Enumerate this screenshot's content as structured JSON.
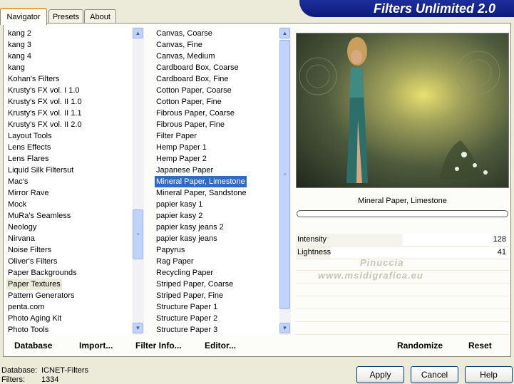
{
  "title": "Filters Unlimited 2.0",
  "tabs": [
    "Navigator",
    "Presets",
    "About"
  ],
  "categories": {
    "items": [
      "kang 2",
      "kang 3",
      "kang 4",
      "kang",
      "Kohan's Filters",
      "Krusty's FX vol. I 1.0",
      "Krusty's FX vol. II 1.0",
      "Krusty's FX vol. II 1.1",
      "Krusty's FX vol. II 2.0",
      "Layout Tools",
      "Lens Effects",
      "Lens Flares",
      "Liquid Silk Filtersut",
      "Mac's",
      "Mirror Rave",
      "Mock",
      "MuRa's Seamless",
      "Neology",
      "Nirvana",
      "Noise Filters",
      "Oliver's Filters",
      "Paper Backgrounds",
      "Paper Textures",
      "Pattern Generators",
      "penta.com",
      "Photo Aging Kit",
      "Photo Tools"
    ],
    "selected": "Paper Textures"
  },
  "filters": {
    "items": [
      "Canvas, Coarse",
      "Canvas, Fine",
      "Canvas, Medium",
      "Cardboard Box, Coarse",
      "Cardboard Box, Fine",
      "Cotton Paper, Coarse",
      "Cotton Paper, Fine",
      "Fibrous Paper, Coarse",
      "Fibrous Paper, Fine",
      "Filter Paper",
      "Hemp Paper 1",
      "Hemp Paper 2",
      "Japanese Paper",
      "Mineral Paper, Limestone",
      "Mineral Paper, Sandstone",
      "papier kasy 1",
      "papier kasy 2",
      "papier kasy jeans 2",
      "papier kasy jeans",
      "Papyrus",
      "Rag Paper",
      "Recycling Paper",
      "Striped Paper, Coarse",
      "Striped Paper, Fine",
      "Structure Paper 1",
      "Structure Paper 2",
      "Structure Paper 3"
    ],
    "selected": "Mineral Paper, Limestone"
  },
  "preview": {
    "filter_name": "Mineral Paper, Limestone",
    "watermark_line1": "Pinuccia",
    "watermark_line2": "www.msldigrafica.eu"
  },
  "params": [
    {
      "name": "Intensity",
      "value": "128",
      "level": 0.5
    },
    {
      "name": "Lightness",
      "value": "41",
      "level": 0.16
    }
  ],
  "bottom_buttons": {
    "database": "Database",
    "import": "Import...",
    "filter_info": "Filter Info...",
    "editor": "Editor...",
    "randomize": "Randomize",
    "reset": "Reset"
  },
  "status": {
    "database_label": "Database:",
    "database_value": "ICNET-Filters",
    "filters_label": "Filters:",
    "filters_value": "1334"
  },
  "dialog_buttons": {
    "apply": "Apply",
    "cancel": "Cancel",
    "help": "Help"
  }
}
